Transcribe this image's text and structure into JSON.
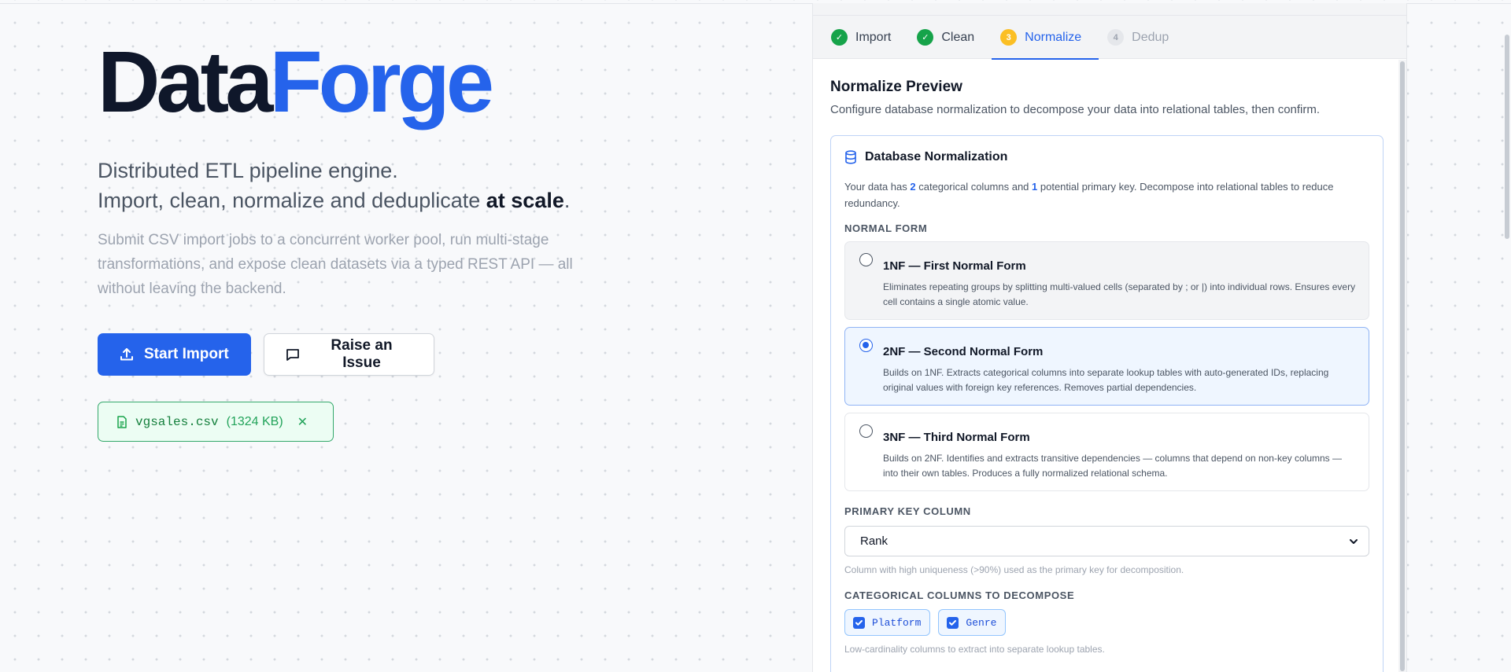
{
  "hero": {
    "brand_dark": "Data",
    "brand_blue": "Forge",
    "tagline_line1": "Distributed ETL pipeline engine.",
    "tagline_line2_prefix": "Import, clean, normalize and deduplicate ",
    "tagline_line2_bold": "at scale",
    "tagline_line2_suffix": ".",
    "description": "Submit CSV import jobs to a concurrent worker pool, run multi-stage transformations, and expose clean datasets via a typed REST API — all without leaving the backend.",
    "start_import_label": "Start Import",
    "raise_issue_label": "Raise an Issue",
    "file_name": "vgsales.csv",
    "file_size": "(1324 KB)",
    "file_close": "✕"
  },
  "tabs": [
    {
      "label": "Import",
      "badge": "✓",
      "state": "done"
    },
    {
      "label": "Clean",
      "badge": "✓",
      "state": "done"
    },
    {
      "label": "Normalize",
      "badge": "3",
      "state": "active"
    },
    {
      "label": "Dedup",
      "badge": "4",
      "state": "pending"
    }
  ],
  "normalize": {
    "title": "Normalize Preview",
    "subtitle": "Configure database normalization to decompose your data into relational tables, then confirm.",
    "card_title": "Database Normalization",
    "intro_a": "Your data has ",
    "intro_count1": "2",
    "intro_b": " categorical columns and ",
    "intro_count2": "1",
    "intro_c": " potential primary key. Decompose into relational tables to reduce redundancy.",
    "normal_form_label": "Normal Form",
    "options": [
      {
        "title": "1NF — First Normal Form",
        "desc": "Eliminates repeating groups by splitting multi-valued cells (separated by ; or |) into individual rows. Ensures every cell contains a single atomic value.",
        "selected": false
      },
      {
        "title": "2NF — Second Normal Form",
        "desc": "Builds on 1NF. Extracts categorical columns into separate lookup tables with auto-generated IDs, replacing original values with foreign key references. Removes partial dependencies.",
        "selected": true
      },
      {
        "title": "3NF — Third Normal Form",
        "desc": "Builds on 2NF. Identifies and extracts transitive dependencies — columns that depend on non-key columns — into their own tables. Produces a fully normalized relational schema.",
        "selected": false
      }
    ],
    "primary_key_label": "Primary Key Column",
    "primary_key_value": "Rank",
    "primary_key_hint": "Column with high uniqueness (>90%) used as the primary key for decomposition.",
    "categorical_label": "Categorical Columns to Decompose",
    "categorical_columns": [
      "Platform",
      "Genre"
    ],
    "categorical_hint": "Low-cardinality columns to extract into separate lookup tables."
  },
  "colors": {
    "accent": "#2563eb",
    "success": "#16a34a",
    "warning": "#fbbf24"
  }
}
